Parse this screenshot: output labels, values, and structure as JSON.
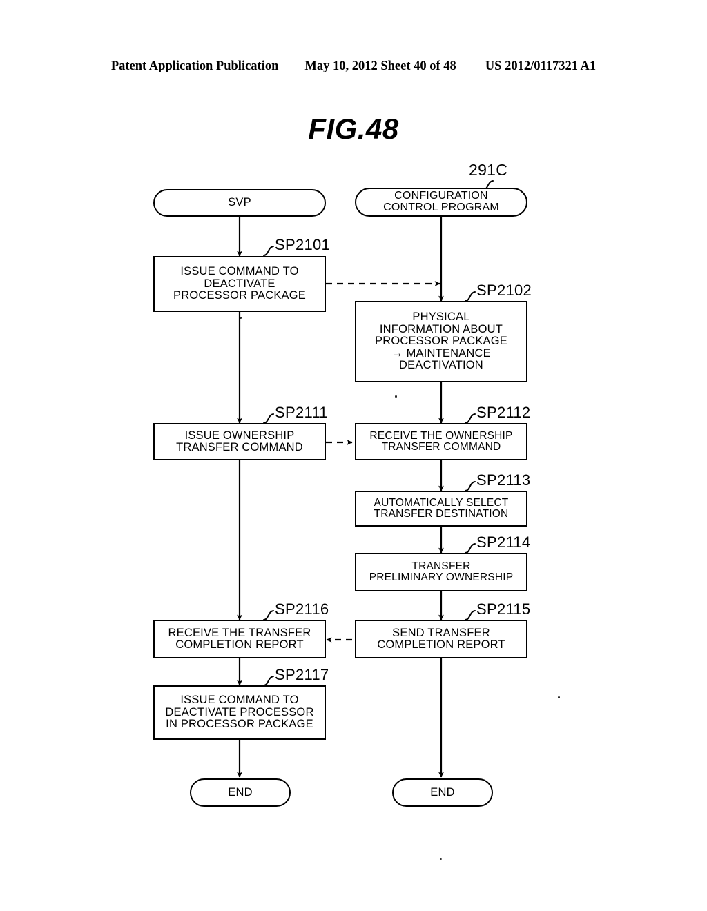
{
  "header": {
    "left": "Patent Application Publication",
    "middle": "May 10, 2012  Sheet 40 of 48",
    "right": "US 2012/0117321 A1"
  },
  "figure": {
    "title": "FIG.48",
    "reference_label": "291C"
  },
  "columns": [
    {
      "name": "svp",
      "start_label": "SVP",
      "end_label": "END"
    },
    {
      "name": "configuration-control-program",
      "start_label": "CONFIGURATION\nCONTROL PROGRAM",
      "end_label": "END"
    }
  ],
  "nodes": [
    {
      "id": "sp2101",
      "step": "SP2101",
      "text": "ISSUE COMMAND TO\nDEACTIVATE\nPROCESSOR PACKAGE",
      "column": "svp"
    },
    {
      "id": "sp2102",
      "step": "SP2102",
      "text": "PHYSICAL\nINFORMATION ABOUT\nPROCESSOR PACKAGE\n→ MAINTENANCE\nDEACTIVATION",
      "column": "configuration-control-program"
    },
    {
      "id": "sp2111",
      "step": "SP2111",
      "text": "ISSUE OWNERSHIP\nTRANSFER COMMAND",
      "column": "svp"
    },
    {
      "id": "sp2112",
      "step": "SP2112",
      "text": "RECEIVE THE OWNERSHIP\nTRANSFER COMMAND",
      "column": "configuration-control-program"
    },
    {
      "id": "sp2113",
      "step": "SP2113",
      "text": "AUTOMATICALLY SELECT\nTRANSFER DESTINATION",
      "column": "configuration-control-program"
    },
    {
      "id": "sp2114",
      "step": "SP2114",
      "text": "TRANSFER\nPRELIMINARY OWNERSHIP",
      "column": "configuration-control-program"
    },
    {
      "id": "sp2115",
      "step": "SP2115",
      "text": "SEND TRANSFER\nCOMPLETION REPORT",
      "column": "configuration-control-program"
    },
    {
      "id": "sp2116",
      "step": "SP2116",
      "text": "RECEIVE THE TRANSFER\nCOMPLETION REPORT",
      "column": "svp"
    },
    {
      "id": "sp2117",
      "step": "SP2117",
      "text": "ISSUE COMMAND TO\nDEACTIVATE PROCESSOR\nIN PROCESSOR PACKAGE",
      "column": "svp"
    }
  ],
  "end_nodes": [
    {
      "id": "end-left",
      "text": "END"
    },
    {
      "id": "end-right",
      "text": "END"
    }
  ]
}
